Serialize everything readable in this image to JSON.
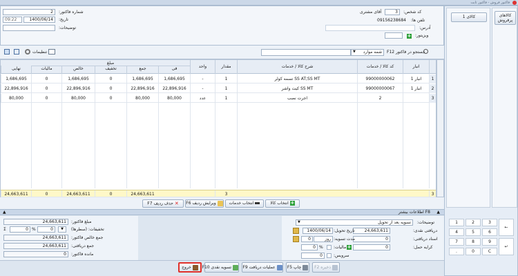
{
  "window": {
    "title": "فاکتور فروش - فاکتور ثابت"
  },
  "header": {
    "customer_code_label": "کد شخص:",
    "customer_code": "3",
    "customer_name": "آقای مشتری",
    "phone_label": "تلفن ها:",
    "phone": "09156238684",
    "address_label": "آدرس:",
    "visitor_label": "ویزیتور:",
    "invoice_no_label": "شماره فاکتور:",
    "invoice_no": "2",
    "date_label": "تاریخ:",
    "date": "1400/06/14",
    "time": "09:22",
    "description_label": "توضیحات:"
  },
  "right_panel": {
    "groups": [
      "کالاهای پرفروش"
    ],
    "items": [
      "کالای 1"
    ],
    "keypad": [
      "1",
      "2",
      "3",
      "4",
      "5",
      "6",
      "7",
      "8",
      "9",
      ".",
      "0",
      "C"
    ]
  },
  "search": {
    "placeholder": "جستجو در فاکتور F12",
    "mode": "شمه موارد"
  },
  "toolbar": {
    "settings": "تنظیمات"
  },
  "columns": {
    "warehouse": "انبار",
    "code": "کد کالا / خدمات",
    "description": "شرح کالا / خدمات",
    "qty": "مقدار",
    "unit": "واحد",
    "amount_group": "مبلغ",
    "unit_price": "فی",
    "total": "جمع",
    "discount": "تخفیف",
    "net": "خالص",
    "tax": "مالیات",
    "final": "نهایی"
  },
  "rows": [
    {
      "num": "1",
      "warehouse": "انبار 1",
      "code": "99000000062",
      "description": "SS AT;SS MT تسمه کولر",
      "qty": "1",
      "unit": "-",
      "unit_price": "1,686,695",
      "total": "1,686,695",
      "discount": "0",
      "net": "1,686,695",
      "tax": "0",
      "final": "1,686,695"
    },
    {
      "num": "2",
      "warehouse": "انبار 1",
      "code": "99000000067",
      "description": "SS MT کیت واشر",
      "qty": "1",
      "unit": "-",
      "unit_price": "22,896,916",
      "total": "22,896,916",
      "discount": "0",
      "net": "22,896,916",
      "tax": "0",
      "final": "22,896,916"
    },
    {
      "num": "3",
      "warehouse": "",
      "code": "2",
      "description": "اجرت نصب",
      "qty": "1",
      "unit": "عدد",
      "unit_price": "80,000",
      "total": "80,000",
      "discount": "0",
      "net": "80,000",
      "tax": "0",
      "final": "80,000"
    }
  ],
  "totals": {
    "count": "3",
    "qty": "3",
    "total": "24,663,611",
    "discount": "0",
    "net": "24,663,611",
    "tax": "0",
    "final": "24,663,611"
  },
  "row_actions": {
    "select_goods": "انتخاب کالا",
    "select_services": "انتخاب خدمات",
    "edit_row": "ویرایش ردیف F6",
    "delete_row": "حذف ردیف F7"
  },
  "more_info": {
    "label": "F8 اطلاعات بیشتر"
  },
  "payment": {
    "desc_label": "توضیحات:",
    "desc_value": "تسویه بعد از تحویل",
    "cash_received_label": "دریافتی نقدی:",
    "cash_received": "24,663,611",
    "card_label": "اسناد دریافتی:",
    "card_value": "0",
    "remaining_label": "کرایه حمل:",
    "remaining_value": "0",
    "delivery_date_label": "تاریخ تحویل:",
    "delivery_date": "1400/06/14",
    "settle_label": "مدت تسویه:",
    "settle_value": "0",
    "settle_unit": "روز",
    "tax_label": "مالیات:",
    "tax_value": "0",
    "tax_pct": "%",
    "service_label": "سرویس:",
    "service_value": "0"
  },
  "summary": {
    "invoice_amount_label": "مبلغ فاکتور:",
    "invoice_amount": "24,663,611",
    "discounts_label": "تخفیفات: (سطرها)",
    "discounts_value": "0",
    "discounts_pct": "0",
    "sigma": "Σ",
    "net_label": "جمع خالص فاکتور:",
    "net_value": "24,663,611",
    "received_label": "جمع دریافتی:",
    "received_value": "24,663,611",
    "balance_label": "مانده فاکتور:",
    "balance_value": "0"
  },
  "bottom_buttons": {
    "save": "ذخیره F2",
    "print": "چاپ F5",
    "receipts": "عملیات دریافت F9",
    "cash_settle": "تسویه نقدی F10",
    "exit": "خروج"
  },
  "colors": {
    "accent_border": "#e0302a",
    "highlight": "#fff8c8",
    "grid_border": "#b6c4d6"
  }
}
